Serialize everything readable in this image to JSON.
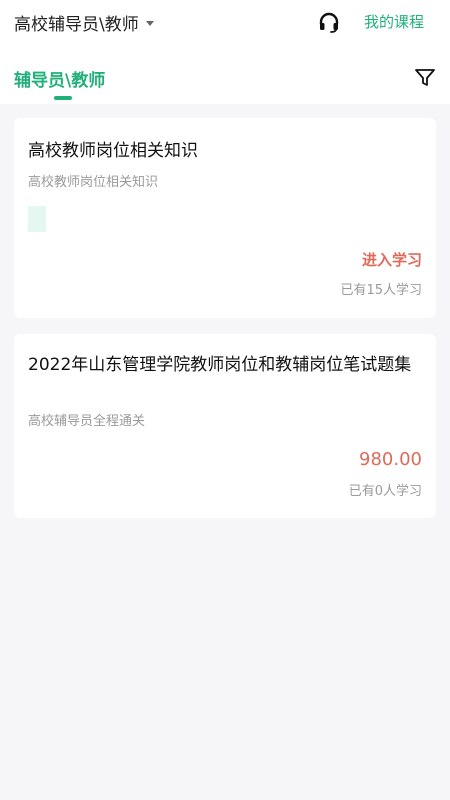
{
  "header": {
    "category_label": "高校辅导员\\教师",
    "my_courses_label": "我的课程",
    "tab_label": "辅导员\\教师",
    "icons": {
      "caret": "caret-down-icon",
      "support": "headset-icon",
      "filter": "filter-icon"
    },
    "accent_color": "#22b07a"
  },
  "courses": [
    {
      "title": "高校教师岗位相关知识",
      "subtitle": "高校教师岗位相关知识",
      "action_label": "进入学习",
      "learners": "已有15人学习"
    },
    {
      "title": "2022年山东管理学院教师岗位和教辅岗位笔试题集",
      "subtitle": "高校辅导员全程通关",
      "price": "980.00",
      "learners": "已有0人学习"
    }
  ],
  "price_color": "#e06a5a"
}
